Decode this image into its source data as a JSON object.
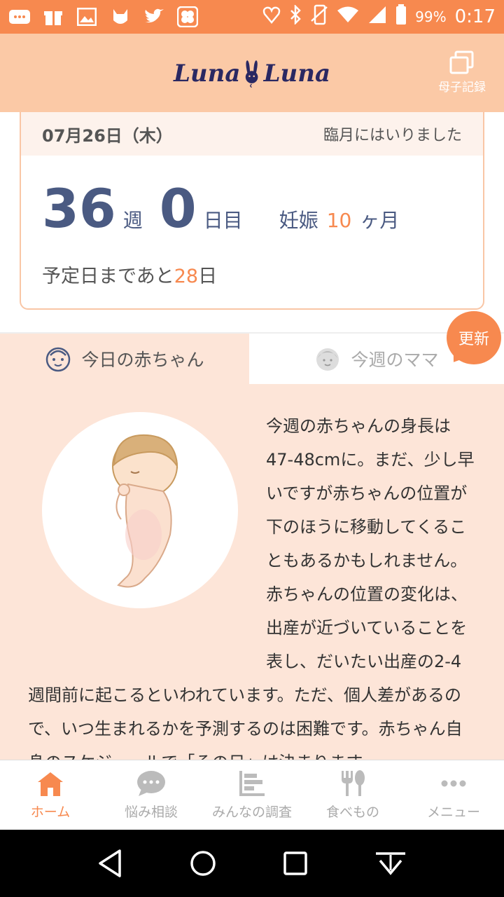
{
  "status_bar": {
    "time": "0:17",
    "battery_percent": "99%",
    "left_icons": [
      "message-icon",
      "gift-icon",
      "image-icon",
      "cat-icon",
      "twitter-icon",
      "clover-icon"
    ],
    "right_icons": [
      "heart-icon",
      "bluetooth-icon",
      "vibrate-icon",
      "wifi-icon",
      "signal-icon",
      "battery-icon"
    ]
  },
  "header": {
    "logo_text_left": "Luna",
    "logo_text_right": "Luna",
    "records_label": "母子記録"
  },
  "date_card": {
    "date": "07月26日（木）",
    "status": "臨月にはいりました",
    "weeks": "36",
    "weeks_unit": "週",
    "days": "0",
    "days_unit": "日目",
    "pregnancy_label": "妊娠",
    "pregnancy_month": "10",
    "pregnancy_month_unit": "ヶ月",
    "due_prefix": "予定日まであと",
    "due_days": "28",
    "due_suffix": "日"
  },
  "tabs": {
    "baby_today": "今日の赤ちゃん",
    "mama_this_week": "今週のママ",
    "update_badge": "更新"
  },
  "article": {
    "text": "今週の赤ちゃんの身長は47-48cmに。まだ、少し早いですが赤ちゃんの位置が下のほうに移動してくることもあるかもしれません。赤ちゃんの位置の変化は、出産が近づいていることを表し、だいたい出産の2-4週間前に起こるといわれています。ただ、個人差があるので、いつ生まれるかを予測するのは困難です。赤ちゃん自身のスケジュールで「その日」は決まります。"
  },
  "bottom_nav": {
    "items": [
      {
        "label": "ホーム",
        "icon": "home-icon",
        "active": true
      },
      {
        "label": "悩み相談",
        "icon": "chat-icon",
        "active": false
      },
      {
        "label": "みんなの調査",
        "icon": "survey-icon",
        "active": false
      },
      {
        "label": "食べもの",
        "icon": "food-icon",
        "active": false
      },
      {
        "label": "メニュー",
        "icon": "menu-icon",
        "active": false
      }
    ]
  },
  "colors": {
    "accent": "#f7894f",
    "header_bg": "#fbc9a6",
    "content_bg": "#fde5d8",
    "navy": "#4a5a82"
  }
}
